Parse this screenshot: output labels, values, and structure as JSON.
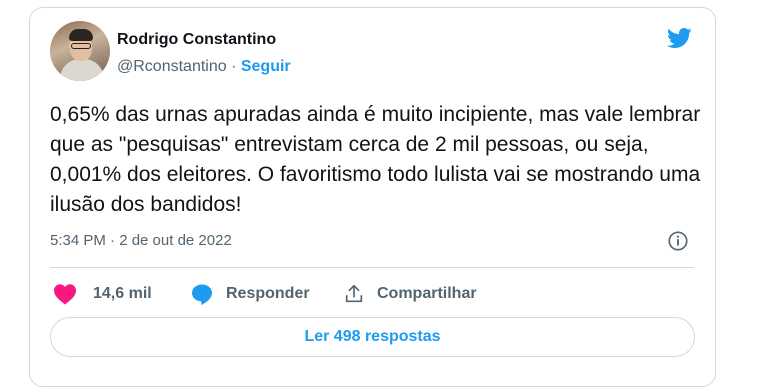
{
  "author": {
    "name": "Rodrigo Constantino",
    "handle": "@Rconstantino",
    "separator": " · ",
    "follow_label": "Seguir"
  },
  "tweet": {
    "text": "0,65% das urnas apuradas ainda é muito incipiente, mas vale lembrar que as \"pesquisas\" entrevistam cerca de 2 mil pessoas, ou seja, 0,001% dos eleitores. O favoritismo todo lulista vai se mostrando uma ilusão dos bandidos!",
    "timestamp": "5:34 PM · 2 de out de 2022"
  },
  "actions": {
    "like_count": "14,6 mil",
    "reply_label": "Responder",
    "share_label": "Compartilhar"
  },
  "read_replies_label": "Ler 498 respostas",
  "colors": {
    "accent": "#1d9bf0",
    "like": "#f91880",
    "muted": "#536471",
    "border": "#cfd9de"
  },
  "icons": [
    "twitter-bird-icon",
    "info-icon",
    "heart-icon",
    "reply-bubble-icon",
    "share-icon"
  ]
}
